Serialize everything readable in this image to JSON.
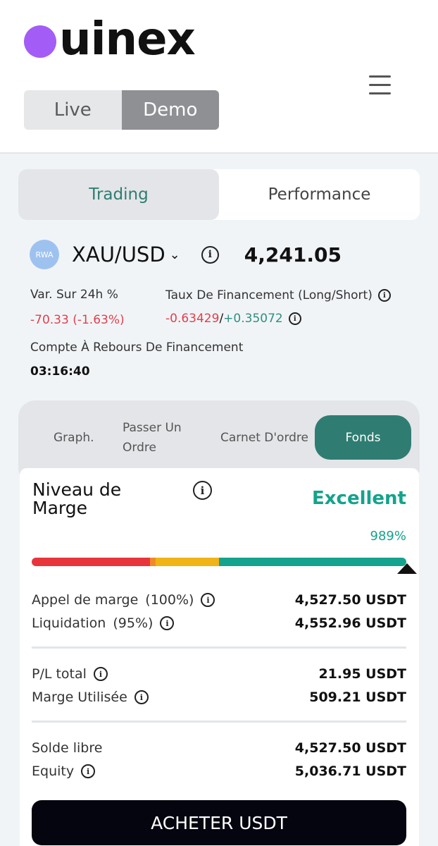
{
  "header": {
    "logo_text": "uinex",
    "mode_toggle": {
      "live": "Live",
      "demo": "Demo",
      "active": "Demo"
    }
  },
  "main_tabs": [
    {
      "label": "Trading",
      "active": true
    },
    {
      "label": "Performance",
      "active": false
    }
  ],
  "pair": {
    "badge": "RWA",
    "name": "XAU/USD",
    "price": "4,241.05"
  },
  "stats": {
    "change_label": "Var. Sur 24h %",
    "change_value": "-70.33 (-1.63%)",
    "funding_label": "Taux De Financement (Long/Short)",
    "funding_long": "-0.63429",
    "funding_sep": "/",
    "funding_short": "+0.35072",
    "countdown_label": "Compte À Rebours De Financement",
    "countdown_value": "03:16:40"
  },
  "sub_tabs": {
    "graph": "Graph.",
    "order_line1": "Passer Un",
    "order_line2": "Ordre",
    "orderbook": "Carnet D'ordre",
    "funds": "Fonds",
    "active": "Fonds"
  },
  "margin": {
    "title": "Niveau de Marge",
    "status": "Excellent",
    "percent": "989%",
    "level_fraction": 0.989,
    "colors": {
      "red": "#e8353c",
      "orange": "#f08a26",
      "yellow": "#f0b416",
      "green": "#14a38c"
    }
  },
  "rows": {
    "margin_call_label": "Appel de marge",
    "margin_call_pct": "(100%)",
    "margin_call_value": "4,527.50 USDT",
    "liquidation_label": "Liquidation",
    "liquidation_pct": "(95%)",
    "liquidation_value": "4,552.96 USDT",
    "pl_label": "P/L total",
    "pl_value": "21.95 USDT",
    "used_margin_label": "Marge Utilisée",
    "used_margin_value": "509.21 USDT",
    "free_balance_label": "Solde libre",
    "free_balance_value": "4,527.50 USDT",
    "equity_label": "Equity",
    "equity_value": "5,036.71 USDT"
  },
  "buy_button": "ACHETER USDT"
}
